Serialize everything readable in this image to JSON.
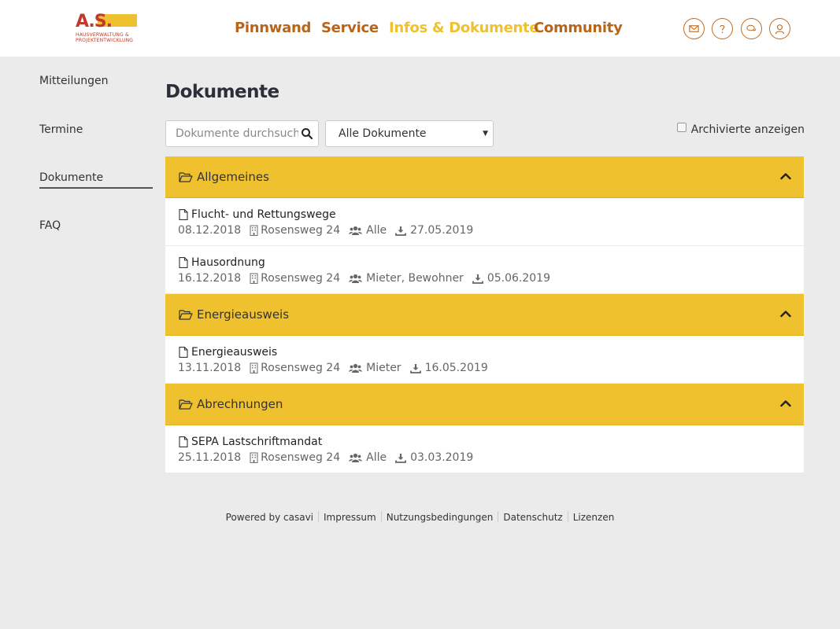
{
  "header": {
    "logo": {
      "main": "A.S.",
      "sub_line1": "HAUSVERWALTUNG &",
      "sub_line2": "PROJEKTENTWICKLUNG"
    },
    "nav": [
      {
        "label": "Pinnwand",
        "active": false
      },
      {
        "label": "Service",
        "active": false
      },
      {
        "label": "Infos & Dokumente",
        "active": true
      },
      {
        "label": "Community",
        "active": false
      }
    ],
    "icons": [
      "mail-icon",
      "help-icon",
      "chat-icon",
      "user-icon"
    ],
    "accent_color": "#f0c12f",
    "nav_color": "#b8641a"
  },
  "sidebar": {
    "items": [
      {
        "label": "Mitteilungen"
      },
      {
        "label": "Termine"
      },
      {
        "label": "Dokumente",
        "active": true
      },
      {
        "label": "FAQ"
      }
    ]
  },
  "main": {
    "title": "Dokumente",
    "search": {
      "placeholder": "Dokumente durchsuchen",
      "value": ""
    },
    "filter": {
      "selected": "Alle Dokumente"
    },
    "archive_label": "Archivierte anzeigen",
    "groups": [
      {
        "title": "Allgemeines",
        "docs": [
          {
            "title": "Flucht- und Rettungswege",
            "date": "08.12.2018",
            "building": "Rosensweg 24",
            "audience": "Alle",
            "download": "27.05.2019"
          },
          {
            "title": "Hausordnung",
            "date": "16.12.2018",
            "building": "Rosensweg 24",
            "audience": "Mieter, Bewohner",
            "download": "05.06.2019"
          }
        ]
      },
      {
        "title": "Energieausweis",
        "docs": [
          {
            "title": "Energieausweis",
            "date": "13.11.2018",
            "building": "Rosensweg 24",
            "audience": "Mieter",
            "download": "16.05.2019"
          }
        ]
      },
      {
        "title": "Abrechnungen",
        "docs": [
          {
            "title": "SEPA Lastschriftmandat",
            "date": "25.11.2018",
            "building": "Rosensweg 24",
            "audience": "Alle",
            "download": "03.03.2019"
          }
        ]
      }
    ]
  },
  "footer": {
    "links": [
      "Powered by casavi",
      "Impressum",
      "Nutzungsbedingungen",
      "Datenschutz",
      "Lizenzen"
    ]
  }
}
